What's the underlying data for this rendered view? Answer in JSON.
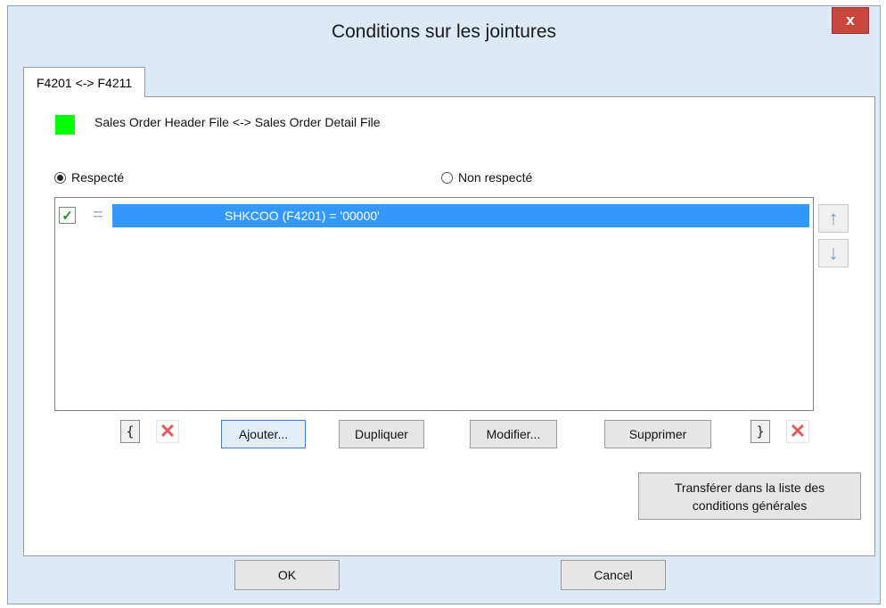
{
  "window": {
    "title": "Conditions sur les jointures",
    "close_label": "x"
  },
  "tab": {
    "label": "F4201 <-> F4211"
  },
  "join": {
    "color": "#00ff00",
    "label": "Sales Order Header File <-> Sales Order Detail File"
  },
  "radios": {
    "respected": {
      "label": "Respecté",
      "selected": true
    },
    "not_respected": {
      "label": "Non respecté",
      "selected": false
    }
  },
  "conditions": [
    {
      "checked": true,
      "operator": "=",
      "text": "SHKCOO (F4201) = '00000'"
    }
  ],
  "buttons": {
    "add": "Ajouter...",
    "duplicate": "Dupliquer",
    "modify": "Modifier...",
    "delete": "Supprimer",
    "open_brace": "{",
    "close_brace": "}",
    "transfer": "Transférer dans la liste des conditions générales",
    "ok": "OK",
    "cancel": "Cancel"
  },
  "icons": {
    "up": "arrow-up-icon",
    "down": "arrow-down-icon",
    "remove": "red-x-icon",
    "check": "checkmark-icon",
    "equals": "equals-icon"
  }
}
